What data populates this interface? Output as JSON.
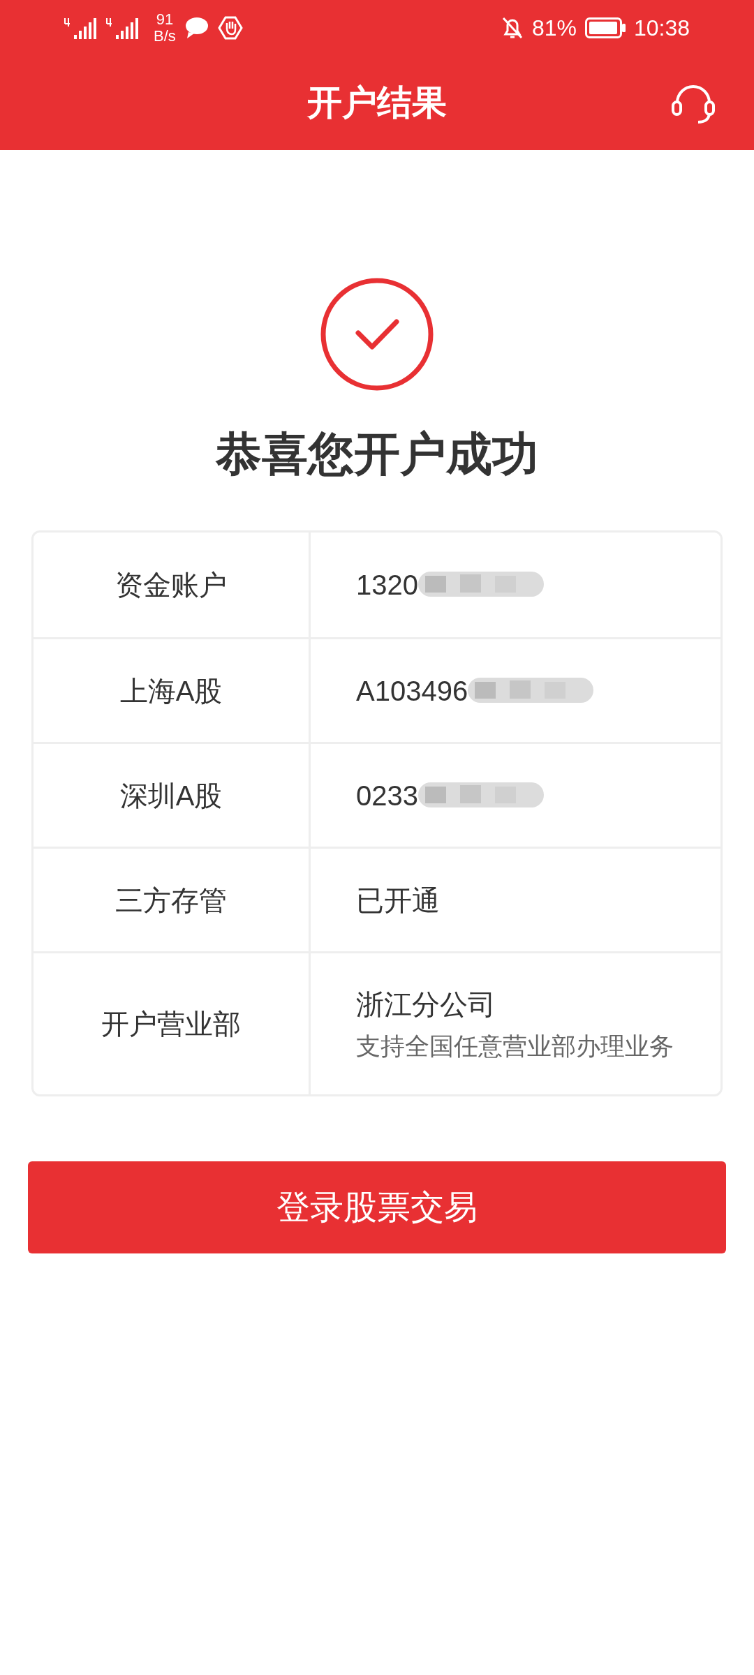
{
  "status_bar": {
    "net_speed_value": "91",
    "net_speed_unit": "B/s",
    "battery": "81%",
    "time": "10:38"
  },
  "header": {
    "title": "开户结果"
  },
  "result": {
    "title": "恭喜您开户成功"
  },
  "table": {
    "rows": [
      {
        "label": "资金账户",
        "value": "1320",
        "redacted": true
      },
      {
        "label": "上海A股",
        "value": "A103496",
        "redacted": true
      },
      {
        "label": "深圳A股",
        "value": "0233",
        "redacted": true
      },
      {
        "label": "三方存管",
        "value": "已开通",
        "redacted": false
      },
      {
        "label": "开户营业部",
        "value": "浙江分公司",
        "note": "支持全国任意营业部办理业务",
        "redacted": false
      }
    ]
  },
  "button": {
    "label": "登录股票交易"
  }
}
